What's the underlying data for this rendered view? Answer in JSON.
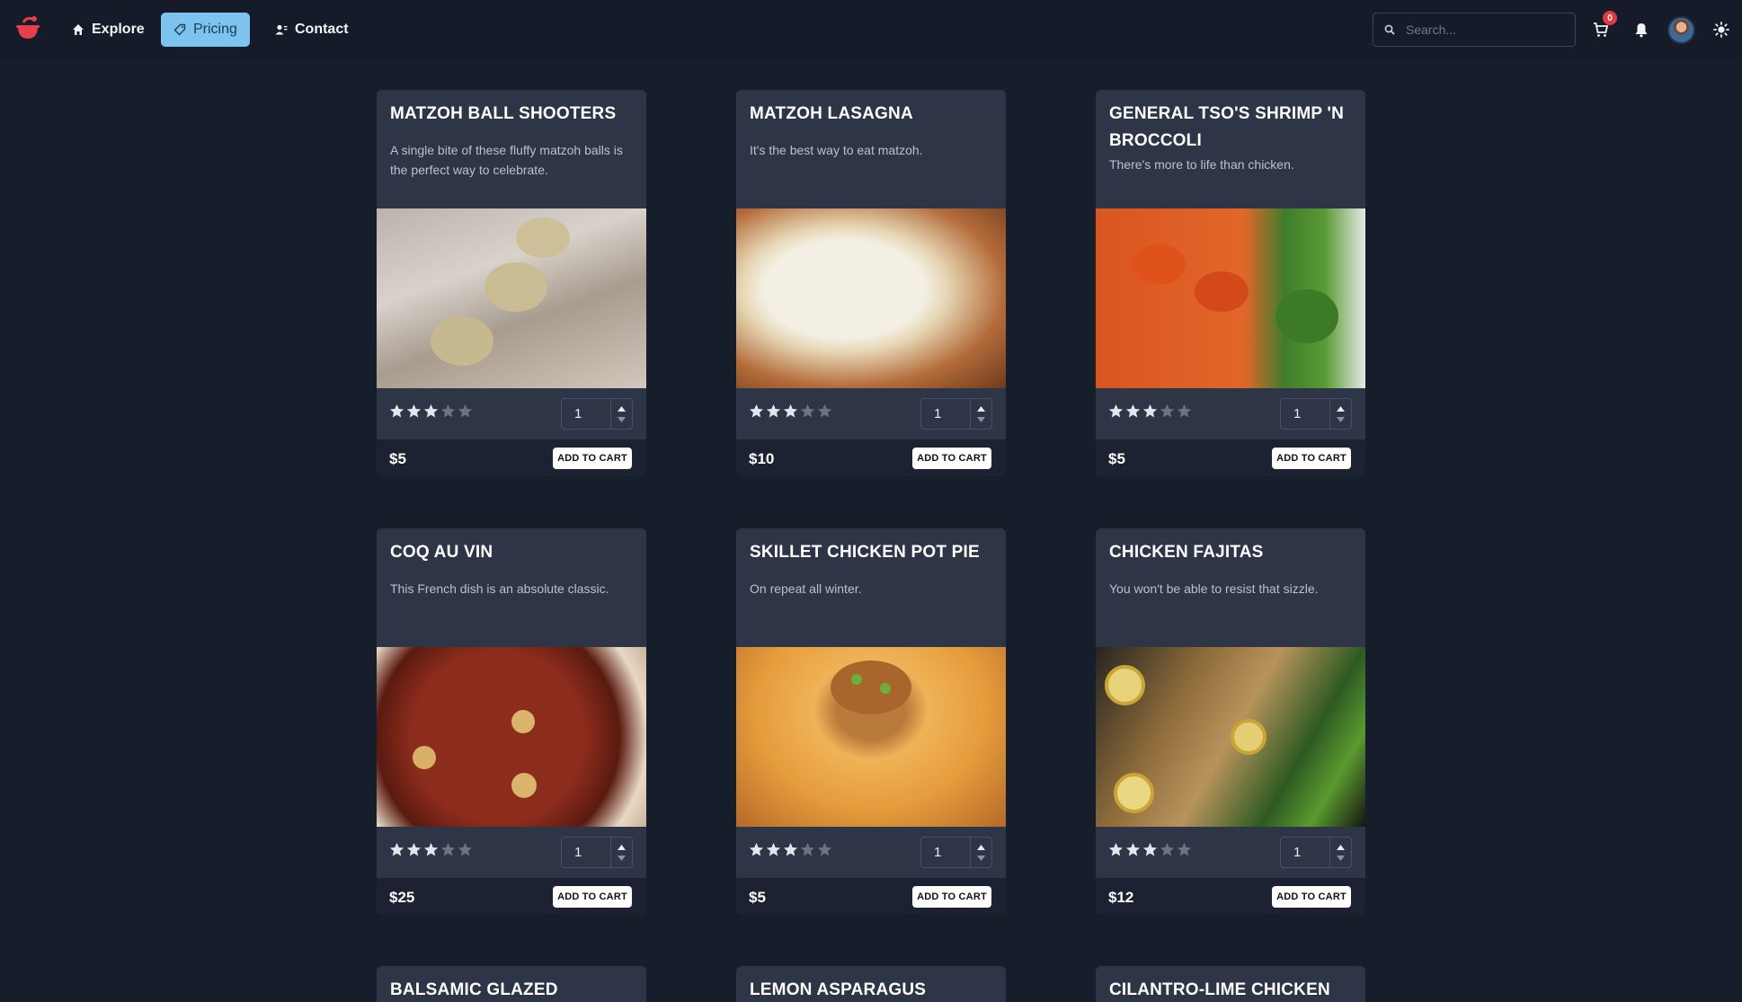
{
  "nav": {
    "items": [
      {
        "label": "Explore",
        "active": false,
        "icon": "home-icon"
      },
      {
        "label": "Pricing",
        "active": true,
        "icon": "tag-icon"
      },
      {
        "label": "Contact",
        "active": false,
        "icon": "contact-icon"
      }
    ],
    "search_placeholder": "Search...",
    "cart_count": "0"
  },
  "products": [
    {
      "title": "MATZOH BALL SHOOTERS",
      "description": "A single bite of these fluffy matzoh balls is the perfect way to celebrate.",
      "rating": 3,
      "quantity": "1",
      "price": "$5",
      "cart_label": "ADD TO CART"
    },
    {
      "title": "MATZOH LASAGNA",
      "description": "It's the best way to eat matzoh.",
      "rating": 3,
      "quantity": "1",
      "price": "$10",
      "cart_label": "ADD TO CART"
    },
    {
      "title": "GENERAL TSO'S SHRIMP 'N BROCCOLI",
      "description": "There's more to life than chicken.",
      "rating": 3,
      "quantity": "1",
      "price": "$5",
      "cart_label": "ADD TO CART"
    },
    {
      "title": "COQ AU VIN",
      "description": "This French dish is an absolute classic.",
      "rating": 3,
      "quantity": "1",
      "price": "$25",
      "cart_label": "ADD TO CART"
    },
    {
      "title": "SKILLET CHICKEN POT PIE",
      "description": "On repeat all winter.",
      "rating": 3,
      "quantity": "1",
      "price": "$5",
      "cart_label": "ADD TO CART"
    },
    {
      "title": "CHICKEN FAJITAS",
      "description": "You won't be able to resist that sizzle.",
      "rating": 3,
      "quantity": "1",
      "price": "$12",
      "cart_label": "ADD TO CART"
    },
    {
      "title": "BALSAMIC GLAZED"
    },
    {
      "title": "LEMON ASPARAGUS"
    },
    {
      "title": "CILANTRO-LIME CHICKEN"
    }
  ],
  "colors": {
    "background": "#161d2b",
    "card": "#2d3547",
    "card_footer": "#1c2231",
    "accent": "#7cc3f0",
    "star_filled": "#e3e6ec",
    "star_empty": "#6b7385",
    "badge": "#e23b3b"
  }
}
